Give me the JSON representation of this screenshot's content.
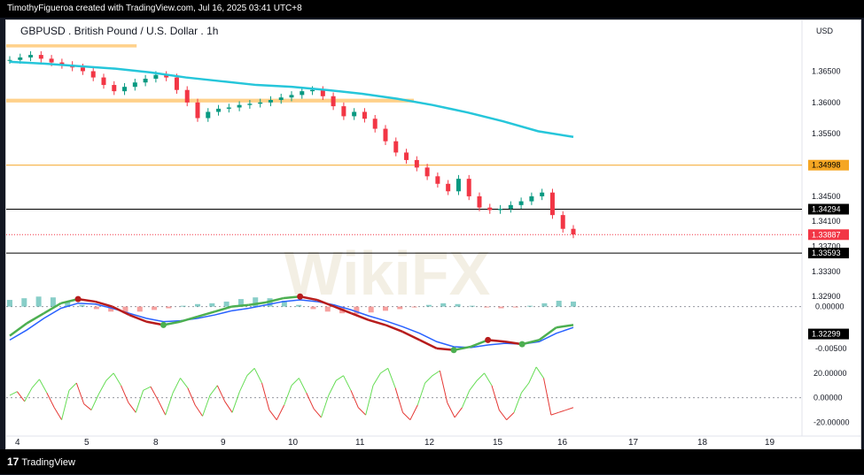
{
  "header": {
    "credit": "TimothyFigueroa created with TradingView.com, Jul 16, 2025 03:41 UTC+8"
  },
  "footer": {
    "logo_mark": "17",
    "logo_text": "TradingView"
  },
  "chart_data": {
    "type": "line",
    "title": "GBPUSD . British Pound / U.S. Dollar . 1h",
    "currency": "USD",
    "watermark": "WikiFX",
    "price_ticks": [
      "1.36500",
      "1.36000",
      "1.35500",
      "1.34500",
      "1.34100",
      "1.33700",
      "1.33300",
      "1.32900"
    ],
    "price_ticks_values": [
      1.365,
      1.36,
      1.355,
      1.345,
      1.341,
      1.337,
      1.333,
      1.329
    ],
    "price_labels": [
      {
        "text": "1.34998",
        "value": 1.34998,
        "style": "orange"
      },
      {
        "text": "1.34294",
        "value": 1.34294,
        "style": "black"
      },
      {
        "text": "1.33887",
        "value": 1.33887,
        "style": "red"
      },
      {
        "text": "1.33593",
        "value": 1.33593,
        "style": "black"
      },
      {
        "text": "1.32299",
        "value": 1.32299,
        "style": "black"
      }
    ],
    "x_ticks": [
      "4",
      "5",
      "8",
      "9",
      "10",
      "11",
      "12",
      "15",
      "16",
      "17",
      "18",
      "19"
    ],
    "price_series": [
      1.3668,
      1.3672,
      1.3676,
      1.367,
      1.3664,
      1.366,
      1.3656,
      1.365,
      1.364,
      1.3628,
      1.3618,
      1.3625,
      1.3632,
      1.3638,
      1.3644,
      1.364,
      1.362,
      1.36,
      1.3575,
      1.3585,
      1.359,
      1.3592,
      1.3596,
      1.3598,
      1.36,
      1.3604,
      1.3608,
      1.3612,
      1.3618,
      1.362,
      1.361,
      1.3594,
      1.3578,
      1.3585,
      1.3574,
      1.3558,
      1.3538,
      1.352,
      1.3508,
      1.3496,
      1.3482,
      1.347,
      1.3458,
      1.3478,
      1.345,
      1.3432,
      1.3428,
      1.343,
      1.3436,
      1.3442,
      1.345,
      1.3456,
      1.342,
      1.3398,
      1.3389
    ],
    "ma_series": [
      1.3665,
      1.3662,
      1.3658,
      1.3654,
      1.3648,
      1.364,
      1.3634,
      1.3628,
      1.3625,
      1.362,
      1.3614,
      1.3606,
      1.3596,
      1.3584,
      1.357,
      1.3554,
      1.3545
    ],
    "horizontal_levels": [
      {
        "value": 1.34998,
        "color": "#f5a623"
      },
      {
        "value": 1.34294,
        "color": "#000000"
      },
      {
        "value": 1.33593,
        "color": "#000000"
      },
      {
        "value": 1.33887,
        "color": "#f23645",
        "dotted": true
      }
    ],
    "zones": [
      {
        "from": 1.3693,
        "to": 1.3688,
        "x0": 0,
        "x1": 0.23
      },
      {
        "from": 1.3606,
        "to": 1.36,
        "x0": 0,
        "x1": 0.5
      }
    ],
    "macd_ticks": [
      "0.00000",
      "-0.00500"
    ],
    "macd_ticks_values": [
      0,
      -0.005
    ],
    "macd_hist": [
      0.0008,
      0.001,
      0.0012,
      0.0011,
      0.0006,
      0.0002,
      -0.0003,
      -0.0006,
      -0.0008,
      -0.0006,
      -0.0004,
      -0.0002,
      0.0001,
      0.0003,
      0.0004,
      0.0006,
      0.0009,
      0.0011,
      0.001,
      0.0007,
      0.0002,
      -0.0003,
      -0.0006,
      -0.0008,
      -0.0009,
      -0.0007,
      -0.0005,
      -0.0003,
      -0.0001,
      0.0002,
      0.0004,
      0.0003,
      0.0001,
      -0.0001,
      -0.0002,
      -0.0001,
      0.0001,
      0.0004,
      0.0007,
      0.0006
    ],
    "macd_fast": [
      -0.0035,
      -0.002,
      -0.0008,
      0.0004,
      0.0009,
      0.0006,
      0.0,
      -0.001,
      -0.0018,
      -0.0022,
      -0.0018,
      -0.0012,
      -0.0006,
      0.0,
      0.0002,
      0.0005,
      0.001,
      0.0012,
      0.0008,
      0.0,
      -0.0008,
      -0.0016,
      -0.0022,
      -0.003,
      -0.004,
      -0.005,
      -0.0052,
      -0.0048,
      -0.004,
      -0.0042,
      -0.0045,
      -0.004,
      -0.0025,
      -0.0022
    ],
    "macd_slow": [
      -0.004,
      -0.0028,
      -0.0014,
      -0.0002,
      0.0004,
      0.0003,
      -0.0002,
      -0.0008,
      -0.0014,
      -0.0018,
      -0.0017,
      -0.0014,
      -0.001,
      -0.0005,
      -0.0002,
      0.0002,
      0.0006,
      0.0008,
      0.0006,
      0.0002,
      -0.0004,
      -0.0011,
      -0.0017,
      -0.0024,
      -0.0032,
      -0.0042,
      -0.0048,
      -0.0049,
      -0.0046,
      -0.0044,
      -0.0045,
      -0.0042,
      -0.0032,
      -0.0025
    ],
    "osc_ticks": [
      "20.00000",
      "0.00000",
      "-20.00000"
    ],
    "osc_ticks_values": [
      20,
      0,
      -20
    ],
    "osc_series": [
      2,
      5,
      -3,
      8,
      15,
      4,
      -8,
      -18,
      6,
      12,
      -5,
      -10,
      3,
      14,
      20,
      10,
      -4,
      -12,
      6,
      9,
      -2,
      -14,
      4,
      16,
      8,
      -6,
      -15,
      2,
      10,
      -3,
      -12,
      5,
      18,
      24,
      12,
      -10,
      -18,
      -6,
      10,
      16,
      4,
      -9,
      -16,
      2,
      14,
      18,
      6,
      -8,
      -14,
      10,
      20,
      24,
      8,
      -12,
      -18,
      -6,
      12,
      18,
      22,
      -4,
      -16,
      -8,
      6,
      14,
      20,
      10,
      -10,
      -18,
      -12,
      4,
      12,
      25,
      16,
      -14,
      -12,
      -10,
      -8
    ],
    "ylim_price": [
      1.33,
      1.372
    ],
    "ylim_macd": [
      -0.0065,
      0.0025
    ],
    "ylim_osc": [
      -24,
      30
    ]
  }
}
